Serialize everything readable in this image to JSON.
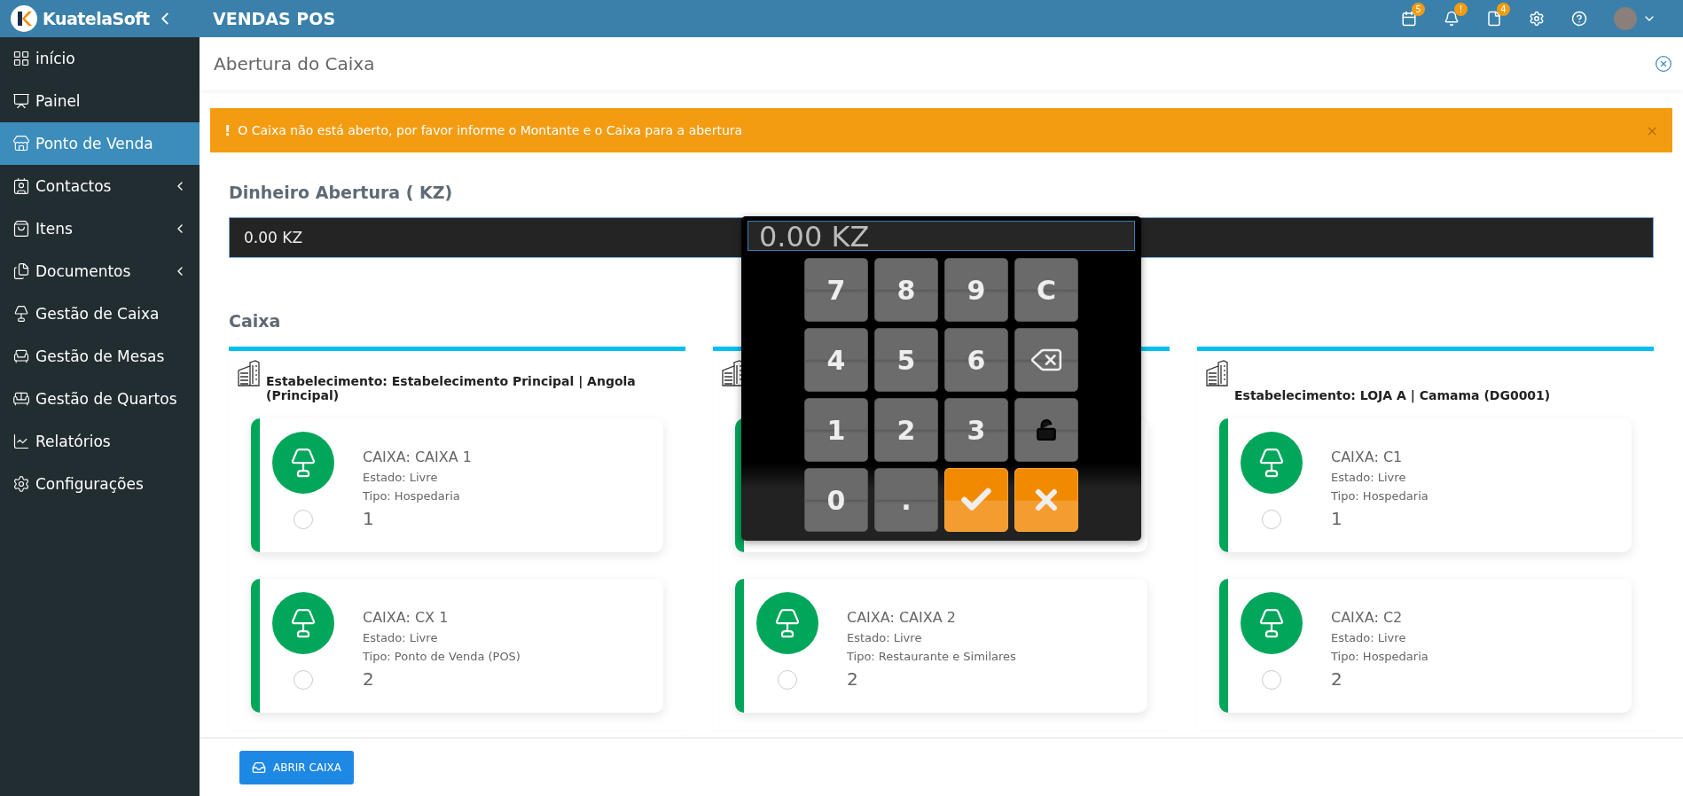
{
  "topbar": {
    "brand": "KuatelaSoft",
    "title": "VENDAS POS",
    "badges": [
      {
        "kind": "calendar",
        "count": "5"
      },
      {
        "kind": "bell",
        "count": "!"
      },
      {
        "kind": "file",
        "count": "4"
      }
    ]
  },
  "sidebar": {
    "items": [
      {
        "label": "início",
        "selected": false,
        "expandable": false
      },
      {
        "label": "Painel",
        "selected": false,
        "expandable": false
      },
      {
        "label": "Ponto de Venda",
        "selected": true,
        "expandable": false
      },
      {
        "label": "Contactos",
        "selected": false,
        "expandable": true
      },
      {
        "label": "Itens",
        "selected": false,
        "expandable": true
      },
      {
        "label": "Documentos",
        "selected": false,
        "expandable": true
      },
      {
        "label": "Gestão de Caixa",
        "selected": false,
        "expandable": false
      },
      {
        "label": "Gestão de Mesas",
        "selected": false,
        "expandable": false
      },
      {
        "label": "Gestão de Quartos",
        "selected": false,
        "expandable": false
      },
      {
        "label": "Relatórios",
        "selected": false,
        "expandable": false
      },
      {
        "label": "Configurações",
        "selected": false,
        "expandable": false
      }
    ]
  },
  "page": {
    "title": "Abertura do Caixa",
    "alert": {
      "icon_text": "!",
      "message": "O Caixa não está aberto, por favor informe o Montante e o Caixa para a abertura",
      "close": "×"
    },
    "amount_label": "Dinheiro Abertura ( KZ)",
    "amount_value": "0.00 KZ",
    "section_title": "Caixa",
    "establishments": [
      {
        "title": "Estabelecimento: Estabelecimento Principal | Angola (Principal)",
        "registers": [
          {
            "kind": "register",
            "name": "CAIXA: CAIXA 1",
            "state": "Estado: Livre",
            "type": "Tipo: Hospedaria",
            "number": "1",
            "selected": false
          },
          {
            "kind": "register",
            "name": "CAIXA: CX 1",
            "state": "Estado: Livre",
            "type": "Tipo: Ponto de Venda (POS)",
            "number": "2",
            "selected": false
          }
        ]
      },
      {
        "registers": [
          {
            "kind": "covered"
          },
          {
            "kind": "register",
            "name": "CAIXA: CAIXA 2",
            "state": "Estado: Livre",
            "type": "Tipo: Restaurante e Similares",
            "number": "2",
            "selected": false
          }
        ]
      },
      {
        "title": "Estabelecimento: LOJA A | Camama (DG0001)",
        "registers": [
          {
            "kind": "register",
            "name": "CAIXA: C1",
            "state": "Estado: Livre",
            "type": "Tipo: Hospedaria",
            "number": "1",
            "selected": false
          },
          {
            "kind": "register",
            "name": "CAIXA: C2",
            "state": "Estado: Livre",
            "type": "Tipo: Hospedaria",
            "number": "2",
            "selected": false
          }
        ]
      }
    ],
    "open_button": "ABRIR CAIXA"
  },
  "keypad": {
    "display": "0.00 KZ",
    "keys": [
      {
        "kind": "digit",
        "label": "7"
      },
      {
        "kind": "digit",
        "label": "8"
      },
      {
        "kind": "digit",
        "label": "9"
      },
      {
        "kind": "digit",
        "label": "C"
      },
      {
        "kind": "digit",
        "label": "4"
      },
      {
        "kind": "digit",
        "label": "5"
      },
      {
        "kind": "digit",
        "label": "6"
      },
      {
        "kind": "backspace"
      },
      {
        "kind": "digit",
        "label": "1"
      },
      {
        "kind": "digit",
        "label": "2"
      },
      {
        "kind": "digit",
        "label": "3"
      },
      {
        "kind": "unlock"
      },
      {
        "kind": "digit",
        "label": "0"
      },
      {
        "kind": "digit",
        "label": "."
      },
      {
        "kind": "confirm"
      },
      {
        "kind": "cancel"
      }
    ]
  }
}
